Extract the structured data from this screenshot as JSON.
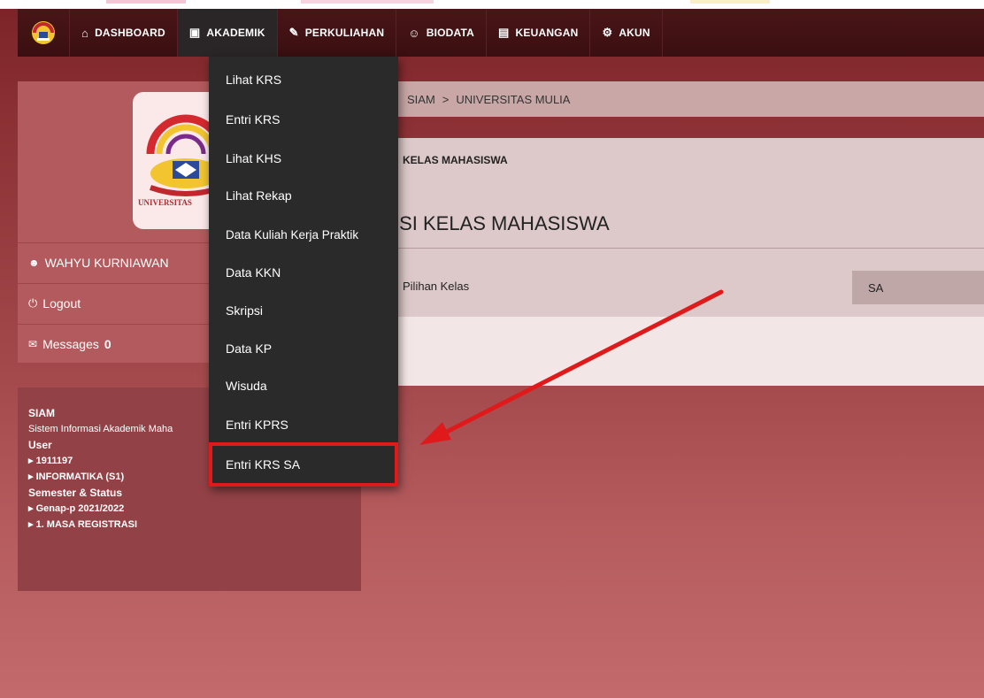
{
  "nav": {
    "items": [
      {
        "label": "DASHBOARD",
        "icon": "home-icon",
        "glyph": "⌂"
      },
      {
        "label": "AKADEMIK",
        "icon": "briefcase-icon",
        "glyph": "▣"
      },
      {
        "label": "PERKULIAHAN",
        "icon": "pencil-icon",
        "glyph": "✎"
      },
      {
        "label": "BIODATA",
        "icon": "user-icon",
        "glyph": "☺"
      },
      {
        "label": "KEUANGAN",
        "icon": "money-icon",
        "glyph": "▤"
      },
      {
        "label": "AKUN",
        "icon": "gears-icon",
        "glyph": "⚙"
      }
    ]
  },
  "dropdown": {
    "items": [
      "Lihat KRS",
      "Entri KRS",
      "Lihat KHS",
      "Lihat Rekap",
      "Data Kuliah Kerja Praktik",
      "Data KKN",
      "Skripsi",
      "Data KP",
      "Wisuda",
      "Entri KPRS",
      "Entri KRS SA"
    ],
    "highlighted": "Entri KRS SA"
  },
  "sidebar": {
    "logo_text": "UNIVERSITAS",
    "user_name": "WAHYU KURNIAWAN",
    "logout_label": "Logout",
    "messages_label": "Messages",
    "messages_count": "0",
    "info": {
      "title": "SIAM",
      "subtitle": "Sistem Informasi Akademik Maha",
      "user_heading": "User",
      "user_id": "1911197",
      "program": "INFORMATIKA (S1)",
      "status_heading": "Semester & Status",
      "semester": "Genap-p 2021/2022",
      "status": "1. MASA REGISTRASI"
    }
  },
  "breadcrumb": {
    "root": "SIAM",
    "separator": ">",
    "current": "UNIVERSITAS MULIA"
  },
  "main": {
    "card_title": "KELAS MAHASISWA",
    "page_title": "ISI KELAS MAHASISWA",
    "field_label": "Pilihan Kelas",
    "select_value": "SA"
  },
  "colors": {
    "navbar": "#3a0f11",
    "dropdown": "#2b2a2a",
    "highlight": "#e01a1a",
    "arrow": "#e01a1a"
  }
}
